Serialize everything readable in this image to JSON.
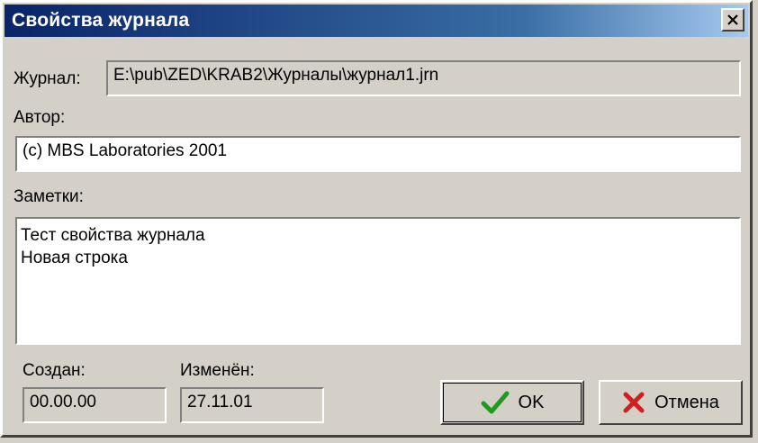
{
  "window": {
    "title": "Свойства журнала"
  },
  "journal": {
    "label": "Журнал:",
    "value": "E:\\pub\\ZED\\KRAB2\\Журналы\\журнал1.jrn"
  },
  "author": {
    "label": "Автор:",
    "value": "(c) MBS Laboratories 2001"
  },
  "notes": {
    "label": "Заметки:",
    "lines": [
      "Тест свойства журнала",
      "Новая строка"
    ]
  },
  "created": {
    "label": "Создан:",
    "value": "00.00.00"
  },
  "modified": {
    "label": "Изменён:",
    "value": "27.11.01"
  },
  "buttons": {
    "ok": "OK",
    "cancel": "Отмена"
  },
  "icons": {
    "ok": "checkmark-icon",
    "cancel": "cross-icon",
    "close": "close-icon"
  },
  "colors": {
    "ok_icon": "#1e9a1e",
    "cancel_icon": "#d02020",
    "title_bar": "#0a246a"
  }
}
